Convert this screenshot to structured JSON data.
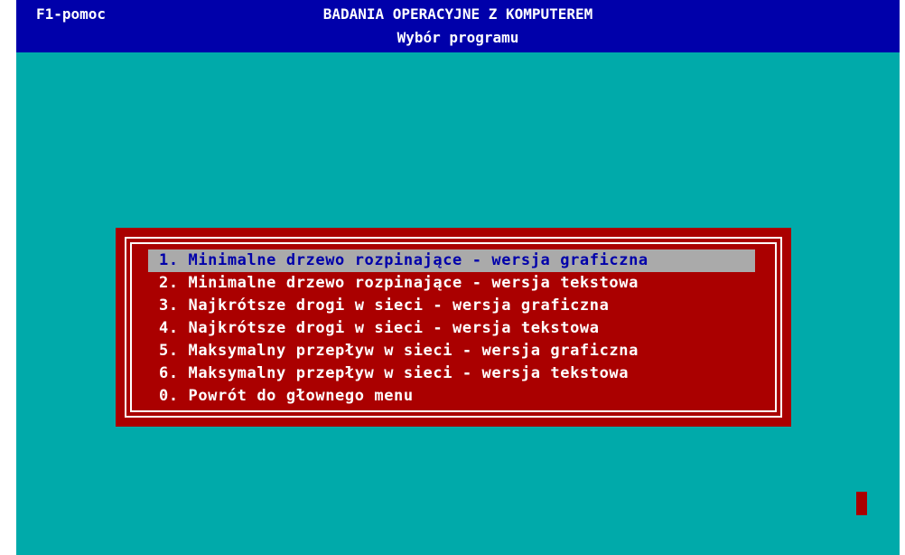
{
  "header": {
    "help_label": "F1-pomoc",
    "title": "BADANIA OPERACYJNE Z KOMPUTEREM",
    "subtitle": "Wybór programu"
  },
  "menu": {
    "selected_index": 0,
    "items": [
      {
        "label": "1. Minimalne drzewo rozpinające - wersja graficzna"
      },
      {
        "label": "2. Minimalne drzewo rozpinające - wersja tekstowa"
      },
      {
        "label": "3. Najkrótsze drogi w sieci - wersja graficzna"
      },
      {
        "label": "4. Najkrótsze drogi w sieci - wersja tekstowa"
      },
      {
        "label": "5. Maksymalny przepływ w sieci - wersja graficzna"
      },
      {
        "label": "6. Maksymalny przepływ w sieci - wersja tekstowa"
      },
      {
        "label": "0. Powrót do głownego menu"
      }
    ]
  },
  "colors": {
    "background": "#00aaaa",
    "header": "#0000aa",
    "menu_box": "#aa0000",
    "highlight": "#aaaaaa",
    "highlight_text": "#0000aa",
    "text": "#ffffff"
  }
}
